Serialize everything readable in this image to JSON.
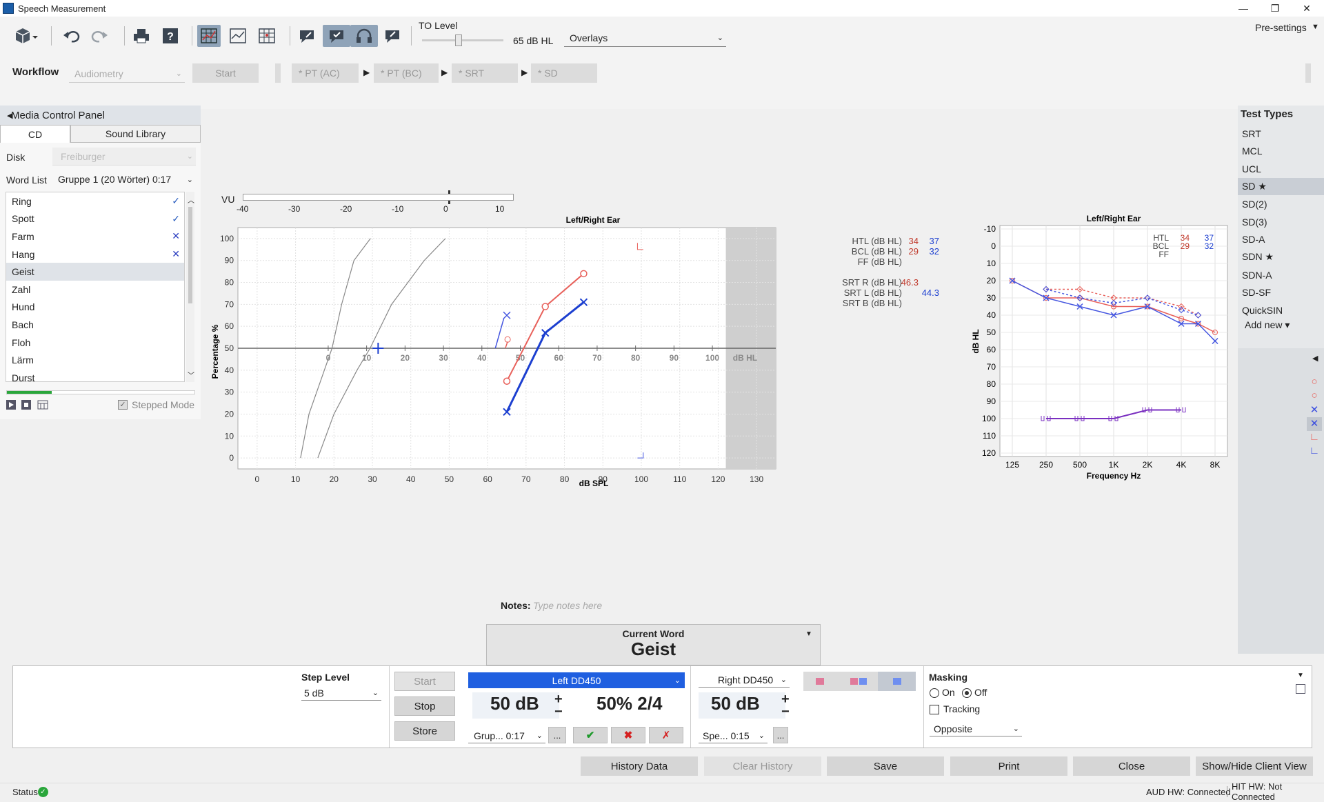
{
  "window": {
    "title": "Speech Measurement",
    "min": "—",
    "restore": "❐",
    "close": "✕"
  },
  "toolbar": {
    "to_level_label": "TO Level",
    "to_level_value": "65 dB HL",
    "to_level_fraction": 0.45,
    "overlays": "Overlays",
    "presettings": "Pre-settings"
  },
  "workflow": {
    "label": "Workflow",
    "select": "Audiometry",
    "start": "Start",
    "steps": [
      "* PT (AC)",
      "* PT (BC)",
      "* SRT",
      "* SD"
    ]
  },
  "media": {
    "title": "Media Control Panel",
    "tabs": [
      "CD",
      "Sound Library"
    ],
    "disk_label": "Disk",
    "disk_value": "Freiburger",
    "wordlist_label": "Word List",
    "wordlist_value": "Gruppe 1 (20 Wörter) 0:17",
    "words": [
      {
        "w": "Ring",
        "m": "✓",
        "c": "#2b5fc0"
      },
      {
        "w": "Spott",
        "m": "✓",
        "c": "#2b5fc0"
      },
      {
        "w": "Farm",
        "m": "✕",
        "c": "#2b3ec0"
      },
      {
        "w": "Hang",
        "m": "✕",
        "c": "#2b3ec0"
      },
      {
        "w": "Geist",
        "m": "",
        "c": ""
      },
      {
        "w": "Zahl",
        "m": "",
        "c": ""
      },
      {
        "w": "Hund",
        "m": "",
        "c": ""
      },
      {
        "w": "Bach",
        "m": "",
        "c": ""
      },
      {
        "w": "Floh",
        "m": "",
        "c": ""
      },
      {
        "w": "Lärm",
        "m": "",
        "c": ""
      },
      {
        "w": "Durst",
        "m": "",
        "c": ""
      }
    ],
    "progress": 0.24,
    "stepped_mode": "Stepped Mode"
  },
  "vu": {
    "label": "VU",
    "ticks": [
      "-40",
      "-30",
      "-20",
      "-10",
      "0",
      "10"
    ]
  },
  "notes": {
    "label": "Notes:",
    "placeholder": "Type notes here"
  },
  "current_word": {
    "label": "Current Word",
    "value": "Geist"
  },
  "test_types": {
    "title": "Test Types",
    "items": [
      "SRT",
      "MCL",
      "UCL",
      "SD ★",
      "SD(2)",
      "SD(3)",
      "SD-A",
      "SDN ★",
      "SDN-A",
      "SD-SF",
      "QuickSIN"
    ],
    "selected": 3,
    "add_new": "Add new ▾",
    "legend_symbols": [
      "○",
      "○",
      "✕",
      "✕",
      "∟",
      "∟"
    ]
  },
  "controls": {
    "step_level_label": "Step Level",
    "step_level": "5 dB",
    "start": "Start",
    "stop": "Stop",
    "store": "Store",
    "left_channel": "Left DD450",
    "left_level": "50 dB",
    "score": "50% 2/4",
    "left_list": "Grup... 0:17",
    "right_channel": "Right DD450",
    "right_level": "50 dB",
    "right_list": "Spe... 0:15",
    "more": "...",
    "masking_label": "Masking",
    "on": "On",
    "off": "Off",
    "tracking": "Tracking",
    "opposite": "Opposite"
  },
  "actions": [
    "History Data",
    "Clear History",
    "Save",
    "Print",
    "Close",
    "Show/Hide Client View"
  ],
  "status": {
    "label": "Status",
    "aud": "AUD HW: Connected",
    "hit": "HIT HW: Not Connected"
  },
  "chart_data": [
    {
      "type": "line",
      "title": "Left/Right Ear",
      "xlabel": "dB SPL",
      "ylabel": "Percentage %",
      "xlim": [
        -5,
        135
      ],
      "ylim": [
        -5,
        105
      ],
      "x_ticks": [
        0,
        10,
        20,
        30,
        40,
        50,
        60,
        70,
        80,
        90,
        100,
        110,
        120,
        130
      ],
      "y_ticks": [
        0,
        10,
        20,
        30,
        40,
        50,
        60,
        70,
        80,
        90,
        100
      ],
      "hl_axis_ticks": [
        "0",
        "10",
        "20",
        "30",
        "40",
        "50",
        "60",
        "70",
        "80",
        "90",
        "100",
        "dB HL"
      ],
      "legend": [
        {
          "label": "HTL (dB HL)",
          "right": "34",
          "left": "37"
        },
        {
          "label": "BCL (dB HL)",
          "right": "29",
          "left": "32"
        },
        {
          "label": "FF (dB HL)",
          "right": "",
          "left": ""
        },
        {
          "label": "SRT R (dB HL)",
          "right": "46.3",
          "left": ""
        },
        {
          "label": "SRT L (dB HL)",
          "right": "",
          "left": "44.3"
        },
        {
          "label": "SRT B (dB HL)",
          "right": "",
          "left": ""
        }
      ],
      "series": [
        {
          "name": "Right",
          "color": "#e8605a",
          "marker": "circle",
          "x": [
            65,
            75,
            85
          ],
          "y": [
            35,
            69,
            84
          ]
        },
        {
          "name": "Left",
          "color": "#1c3fd0",
          "marker": "x",
          "x": [
            65,
            75,
            85
          ],
          "y": [
            21,
            57,
            71
          ]
        }
      ],
      "reference_curves": [
        {
          "x": [
            11.3,
            13.5,
            17.5,
            19.5,
            22,
            25.2,
            29.5
          ],
          "y": [
            0,
            20,
            40,
            50,
            70,
            90,
            100
          ]
        },
        {
          "x": [
            15.8,
            20,
            26,
            29.4,
            35,
            43.5,
            49
          ],
          "y": [
            0,
            20,
            40,
            50,
            70,
            90,
            100
          ]
        }
      ]
    },
    {
      "type": "line",
      "title": "Left/Right Ear",
      "xlabel": "Frequency Hz",
      "ylabel": "dB HL",
      "x_categories": [
        "125",
        "250",
        "500",
        "1K",
        "2K",
        "4K",
        "8K"
      ],
      "ylim": [
        -10,
        120
      ],
      "y_ticks": [
        -10,
        0,
        10,
        20,
        30,
        40,
        50,
        60,
        70,
        80,
        90,
        100,
        110,
        120
      ],
      "legend": [
        {
          "label": "HTL",
          "right": "34",
          "left": "37"
        },
        {
          "label": "BCL",
          "right": "29",
          "left": "32"
        },
        {
          "label": "FF",
          "right": "",
          "left": ""
        }
      ],
      "series": [
        {
          "name": "Right AC",
          "color": "#e8605a",
          "x": [
            0,
            1,
            2,
            3,
            4,
            5,
            5.5,
            6
          ],
          "y": [
            20,
            30,
            30,
            35,
            35,
            42,
            45,
            50
          ]
        },
        {
          "name": "Left AC",
          "color": "#4455e0",
          "x": [
            0,
            1,
            2,
            3,
            4,
            5,
            5.5,
            6
          ],
          "y": [
            20,
            30,
            35,
            40,
            35,
            45,
            45,
            55
          ]
        },
        {
          "name": "Right BC",
          "color": "#e8605a",
          "x": [
            1,
            2,
            3,
            4,
            5,
            5.5
          ],
          "y": [
            25,
            25,
            30,
            30,
            35,
            40
          ]
        },
        {
          "name": "Left BC",
          "color": "#4455e0",
          "x": [
            1,
            2,
            3,
            4,
            5,
            5.5
          ],
          "y": [
            25,
            30,
            33,
            30,
            37,
            40
          ]
        },
        {
          "name": "Masked",
          "color": "#7a2fc0",
          "x": [
            1,
            2,
            3,
            4,
            5
          ],
          "y": [
            100,
            100,
            100,
            95,
            95
          ]
        }
      ]
    }
  ]
}
